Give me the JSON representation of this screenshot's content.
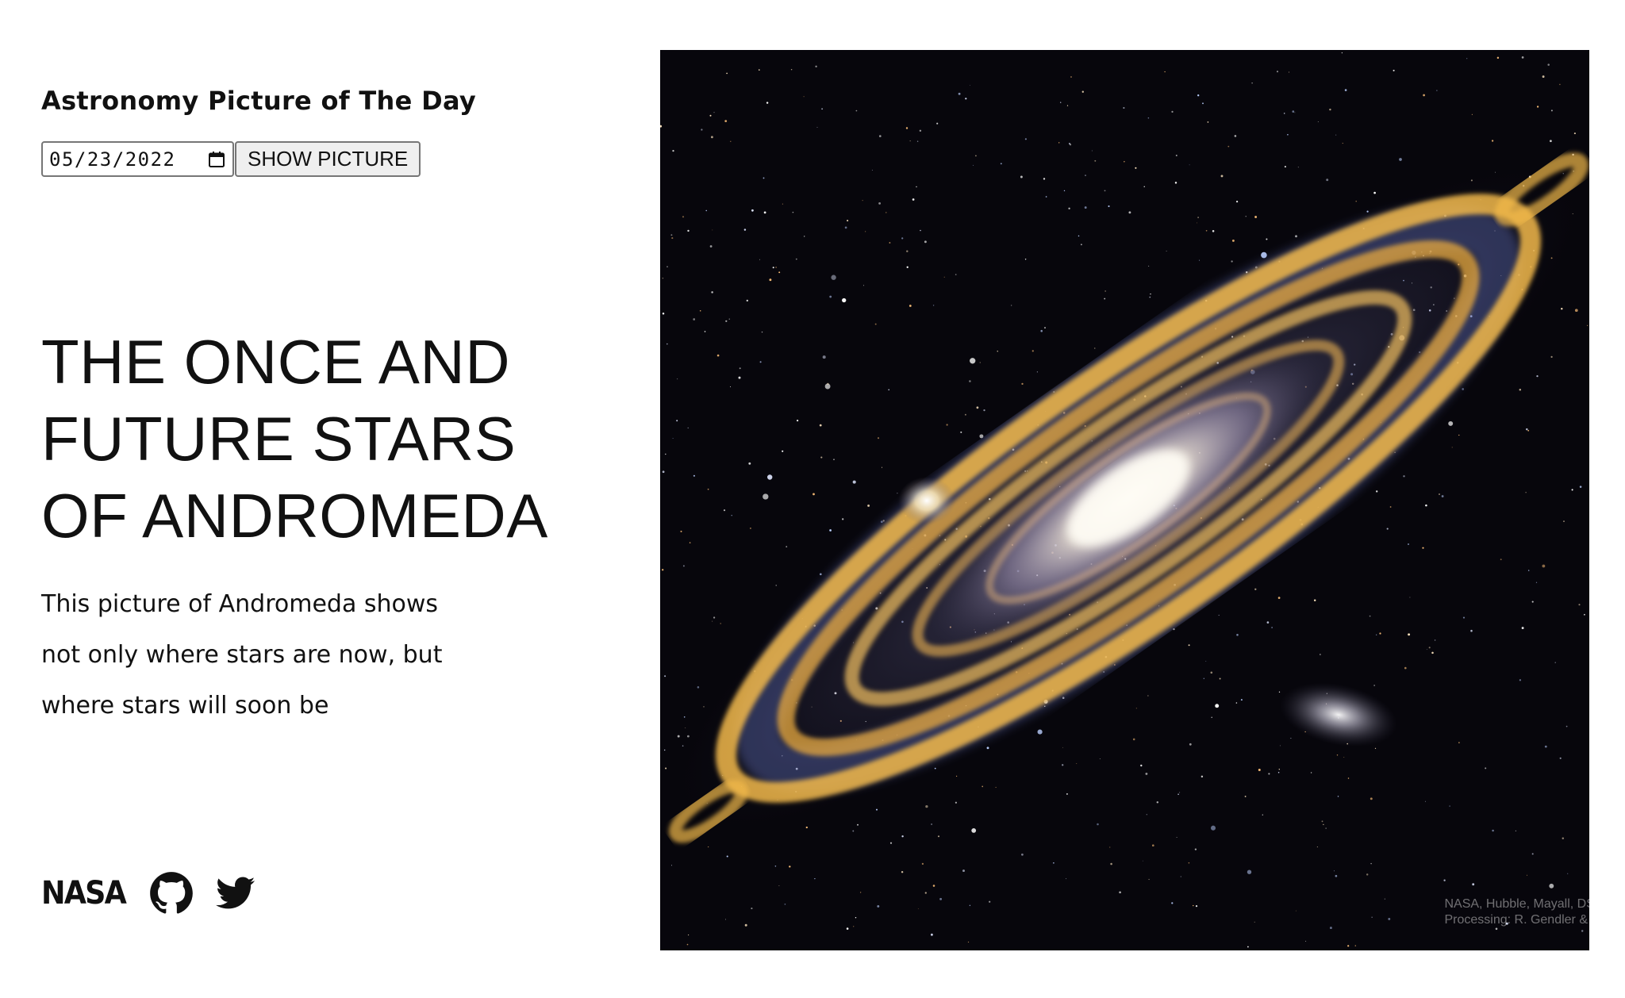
{
  "header": {
    "title": "Astronomy Picture of The Day"
  },
  "controls": {
    "date_value": "05/23/2022",
    "show_button_label": "SHOW PICTURE",
    "calendar_icon": "calendar-icon"
  },
  "apod": {
    "title_lines": [
      "THE ONCE AND",
      "FUTURE STARS",
      "OF ANDROMEDA"
    ],
    "description_lines": [
      "This picture of Andromeda shows",
      "not only where stars are now, but",
      "where stars will soon be"
    ],
    "image_credit_lines": [
      "NASA, Hubble, Mayall, DS",
      "Processing: R. Gendler & R"
    ]
  },
  "social": {
    "nasa_logo": "NASA",
    "icons": [
      "nasa-logo",
      "github-icon",
      "twitter-icon"
    ]
  },
  "colors": {
    "text": "#111111",
    "button_bg": "#efefef",
    "border": "#767676",
    "space": "#07060c",
    "dust": "#f2b94a"
  }
}
